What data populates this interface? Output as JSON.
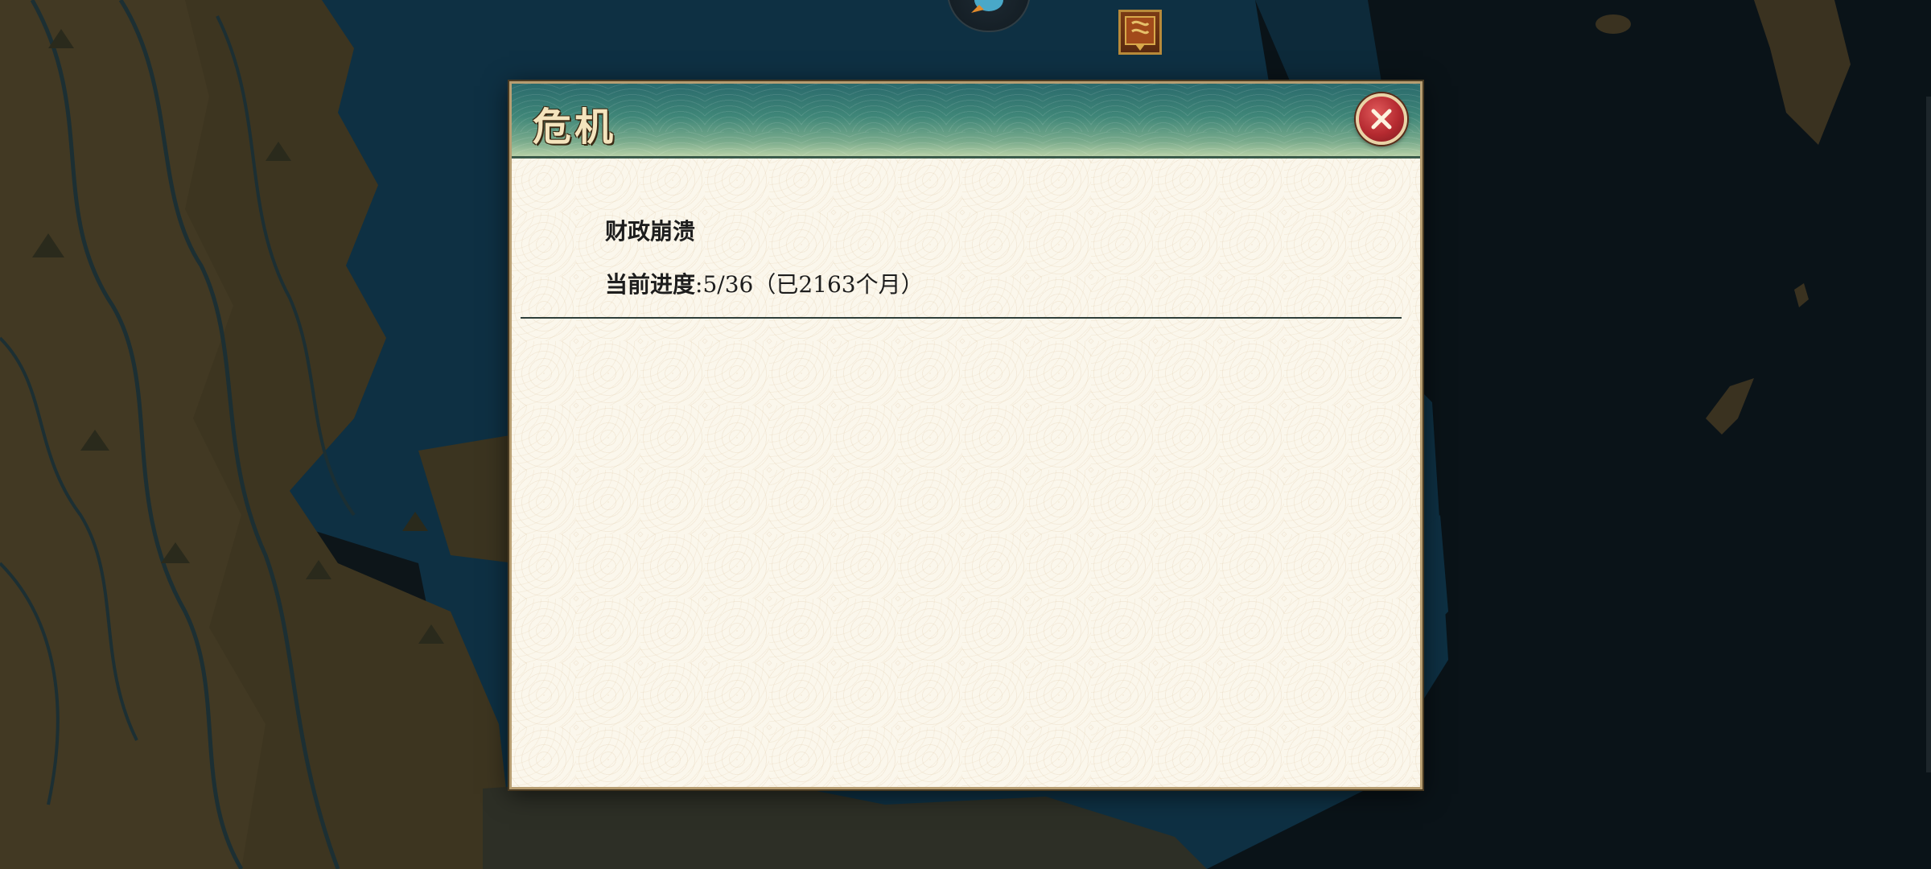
{
  "dialog": {
    "title": "危机",
    "close_icon": "close-x-icon",
    "crisis_name": "财政崩溃",
    "progress_label": "当前进度",
    "progress_value": ":5/36",
    "progress_elapsed": "（已2163个月）",
    "progress_current": 5,
    "progress_total": 36,
    "months_elapsed": 2163
  },
  "map": {
    "top_icons": [
      "bird-unit-icon",
      "banner-icon"
    ]
  },
  "colors": {
    "header_teal": "#3f8678",
    "close_red": "#b52a30",
    "panel_bg": "#fbf7ec",
    "title_text": "#f4e4bd",
    "land": "#3b3420",
    "sea": "#0f3346"
  }
}
